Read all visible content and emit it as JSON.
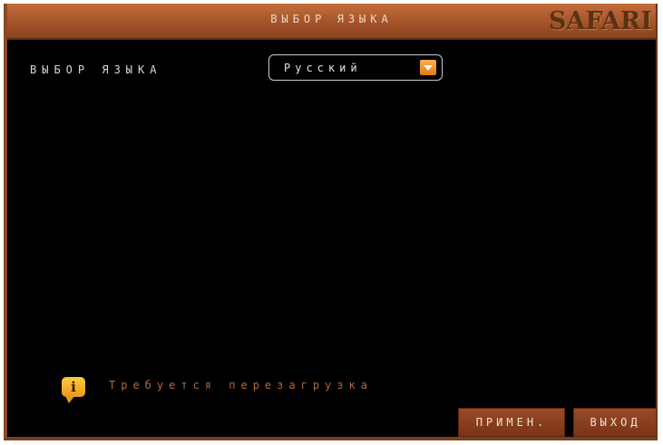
{
  "window": {
    "title": "ВЫБОР ЯЗЫКА",
    "brand": "SAFARI"
  },
  "language": {
    "label": "ВЫБОР ЯЗЫКА",
    "selected": "Русский",
    "dropdown_icon": "chevron-down-icon"
  },
  "notice": {
    "icon": "info-icon",
    "icon_glyph": "i",
    "text": "Требуется перезагрузка"
  },
  "buttons": {
    "apply": "ПРИМЕН.",
    "exit": "ВЫХОД"
  },
  "colors": {
    "titlebar": "#a4532a",
    "accent": "#e27a14",
    "notice_text": "#b06a3a"
  }
}
